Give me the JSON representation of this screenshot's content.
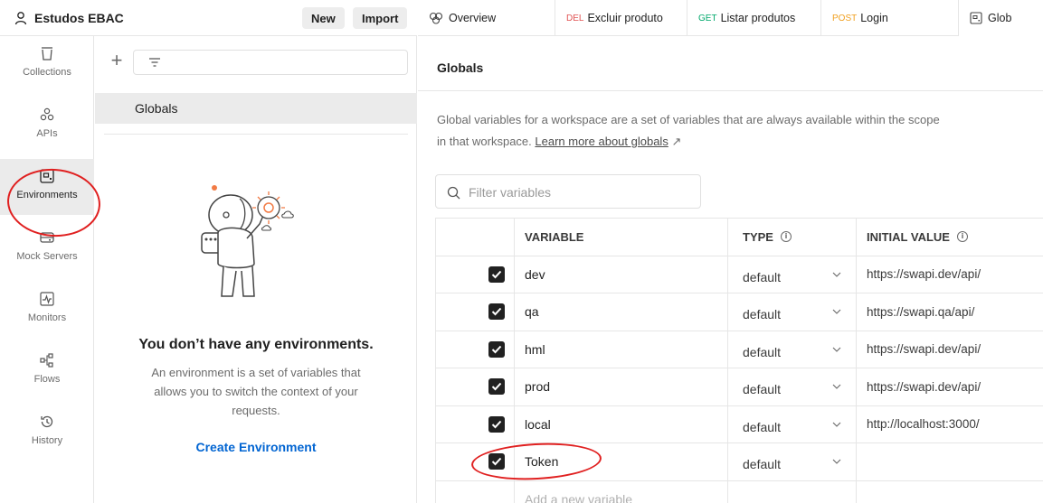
{
  "workspace": {
    "name": "Estudos EBAC",
    "new_label": "New",
    "import_label": "Import"
  },
  "sidebar": {
    "items": [
      {
        "label": "Collections",
        "icon": "trash-can-icon"
      },
      {
        "label": "APIs",
        "icon": "apis-icon"
      },
      {
        "label": "Environments",
        "icon": "environment-icon"
      },
      {
        "label": "Mock Servers",
        "icon": "mock-server-icon"
      },
      {
        "label": "Monitors",
        "icon": "monitor-icon"
      },
      {
        "label": "Flows",
        "icon": "flows-icon"
      },
      {
        "label": "History",
        "icon": "history-icon"
      }
    ],
    "active": "Environments"
  },
  "env_panel": {
    "globals_label": "Globals",
    "empty_title": "You don’t have any environments.",
    "empty_desc_1": "An environment is a set of variables that",
    "empty_desc_2": "allows you to switch the context of your",
    "empty_desc_3": "requests.",
    "create_label": "Create Environment"
  },
  "tabs": [
    {
      "method": "",
      "label": "Overview"
    },
    {
      "method": "DEL",
      "label": "Excluir produto",
      "color": "#e05252"
    },
    {
      "method": "GET",
      "label": "Listar produtos",
      "color": "#00a86b"
    },
    {
      "method": "POST",
      "label": "Login",
      "color": "#f0a020"
    },
    {
      "method": "",
      "label": "Glob"
    }
  ],
  "main": {
    "title": "Globals",
    "desc_line1": "Global variables for a workspace are a set of variables that are always available within the scope",
    "desc_line2_prefix": "in that workspace. ",
    "learn_more": "Learn more about globals",
    "learn_arrow": "↗",
    "filter_placeholder": "Filter variables"
  },
  "table": {
    "headers": {
      "variable": "VARIABLE",
      "type": "TYPE",
      "initial": "INITIAL VALUE"
    },
    "rows": [
      {
        "variable": "dev",
        "type": "default",
        "initial": "https://swapi.dev/api/"
      },
      {
        "variable": "qa",
        "type": "default",
        "initial": "https://swapi.qa/api/"
      },
      {
        "variable": "hml",
        "type": "default",
        "initial": "https://swapi.dev/api/"
      },
      {
        "variable": "prod",
        "type": "default",
        "initial": "https://swapi.dev/api/"
      },
      {
        "variable": "local",
        "type": "default",
        "initial": "http://localhost:3000/"
      },
      {
        "variable": "Token",
        "type": "default",
        "initial": ""
      }
    ],
    "add_placeholder": "Add a new variable"
  },
  "colors": {
    "accent_blue": "#0265d2",
    "annotation_red": "#e02020"
  }
}
